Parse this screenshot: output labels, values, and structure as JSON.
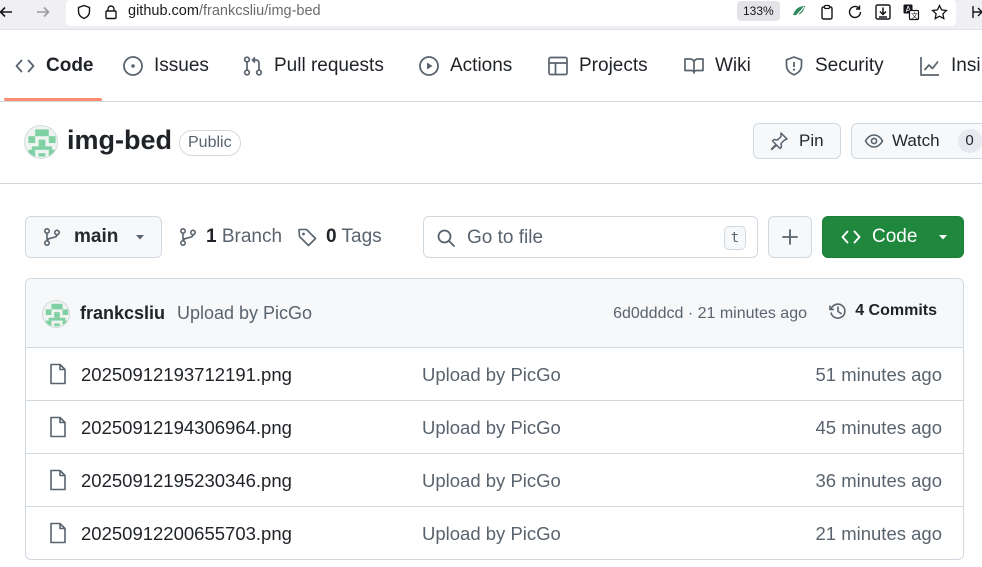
{
  "browser": {
    "url_host": "github.com",
    "url_path": "/frankcsliu/img-bed",
    "zoom": "133%",
    "icons": [
      "back-arrow-icon",
      "forward-arrow-icon",
      "shield-icon",
      "lock-icon",
      "extension-icon",
      "clipboard-icon",
      "reload-icon",
      "download-icon",
      "translate-icon",
      "bookmark-star-icon"
    ]
  },
  "nav": {
    "tabs": [
      {
        "label": "Code",
        "icon": "code-icon",
        "selected": true
      },
      {
        "label": "Issues",
        "icon": "issue-icon"
      },
      {
        "label": "Pull requests",
        "icon": "pull-request-icon"
      },
      {
        "label": "Actions",
        "icon": "play-icon"
      },
      {
        "label": "Projects",
        "icon": "table-icon"
      },
      {
        "label": "Wiki",
        "icon": "book-icon"
      },
      {
        "label": "Security",
        "icon": "shield-icon"
      },
      {
        "label": "Insi",
        "icon": "graph-icon"
      }
    ]
  },
  "repo": {
    "name": "img-bed",
    "visibility": "Public",
    "pin_label": "Pin",
    "watch_label": "Watch",
    "watch_count": "0"
  },
  "toolbar": {
    "branch": "main",
    "branch_count": "1",
    "branch_label": "Branch",
    "tag_count": "0",
    "tag_label": "Tags",
    "search_placeholder": "Go to file",
    "search_shortcut": "t",
    "code_label": "Code"
  },
  "latest_commit": {
    "author": "frankcsliu",
    "message": "Upload by PicGo",
    "hash_time": "6d0dddcd · 21 minutes ago",
    "commit_count": "4",
    "commits_label": "Commits"
  },
  "files": [
    {
      "name": "20250912193712191.png",
      "message": "Upload by PicGo",
      "age": "51 minutes ago"
    },
    {
      "name": "20250912194306964.png",
      "message": "Upload by PicGo",
      "age": "45 minutes ago"
    },
    {
      "name": "20250912195230346.png",
      "message": "Upload by PicGo",
      "age": "36 minutes ago"
    },
    {
      "name": "20250912200655703.png",
      "message": "Upload by PicGo",
      "age": "21 minutes ago"
    }
  ],
  "colors": {
    "accent_underline": "#fd8c73",
    "code_button": "#1f883d",
    "avatar_green": "#7fd0a2"
  }
}
